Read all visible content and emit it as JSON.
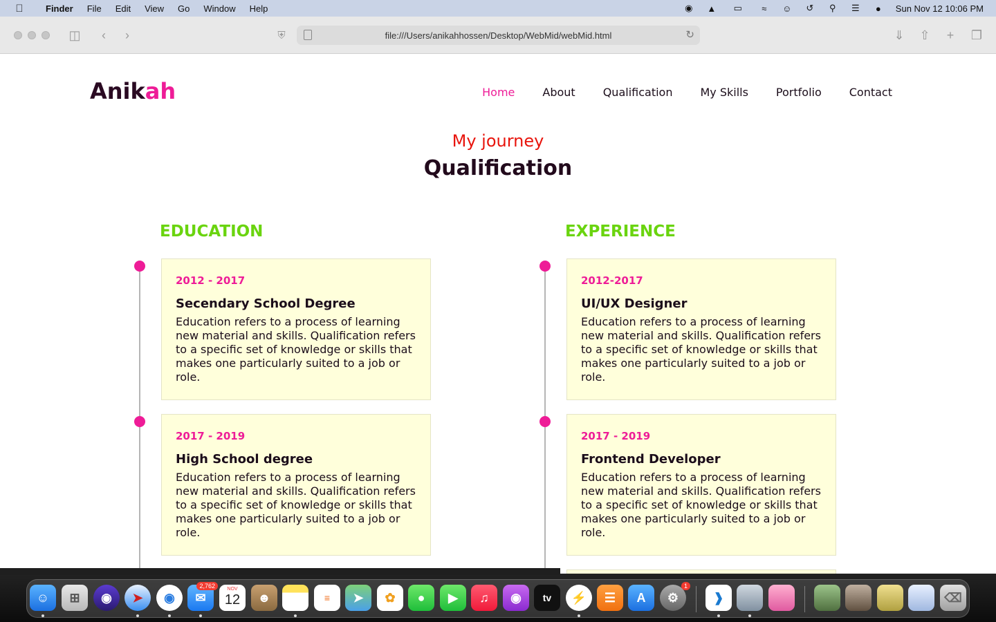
{
  "menubar": {
    "app": "Finder",
    "menus": [
      "File",
      "Edit",
      "View",
      "Go",
      "Window",
      "Help"
    ],
    "clock": "Sun Nov 12  10:06 PM"
  },
  "browser": {
    "url": "file:///Users/anikahhossen/Desktop/WebMid/webMid.html"
  },
  "site": {
    "logo_main": "Anik",
    "logo_accent": "ah",
    "nav": [
      "Home",
      "About",
      "Qualification",
      "My Skills",
      "Portfolio",
      "Contact"
    ],
    "subtitle": "My journey",
    "title": "Qualification",
    "education": {
      "heading": "EDUCATION",
      "items": [
        {
          "years": "2012 - 2017",
          "title": "Secendary School Degree",
          "desc": "Education refers to a process of learning new material and skills. Qualification refers to a specific set of knowledge or skills that makes one particularly suited to a job or role."
        },
        {
          "years": "2017 - 2019",
          "title": "High School degree",
          "desc": "Education refers to a process of learning new material and skills. Qualification refers to a specific set of knowledge or skills that makes one particularly suited to a job or role."
        }
      ]
    },
    "experience": {
      "heading": "EXPERIENCE",
      "items": [
        {
          "years": "2012-2017",
          "title": "UI/UX Designer",
          "desc": "Education refers to a process of learning new material and skills. Qualification refers to a specific set of knowledge or skills that makes one particularly suited to a job or role."
        },
        {
          "years": "2017 - 2019",
          "title": "Frontend Developer",
          "desc": "Education refers to a process of learning new material and skills. Qualification refers to a specific set of knowledge or skills that makes one particularly suited to a job or role."
        }
      ]
    }
  },
  "dock": {
    "mail_badge": "2,762",
    "calendar_month": "NOV",
    "calendar_day": "12",
    "settings_badge": "1",
    "tv_label": "tv"
  },
  "colors": {
    "accent_pink": "#ee1c97",
    "subtitle_red": "#e8140c",
    "heading_green": "#6ad40f",
    "card_bg": "#ffffdb"
  }
}
